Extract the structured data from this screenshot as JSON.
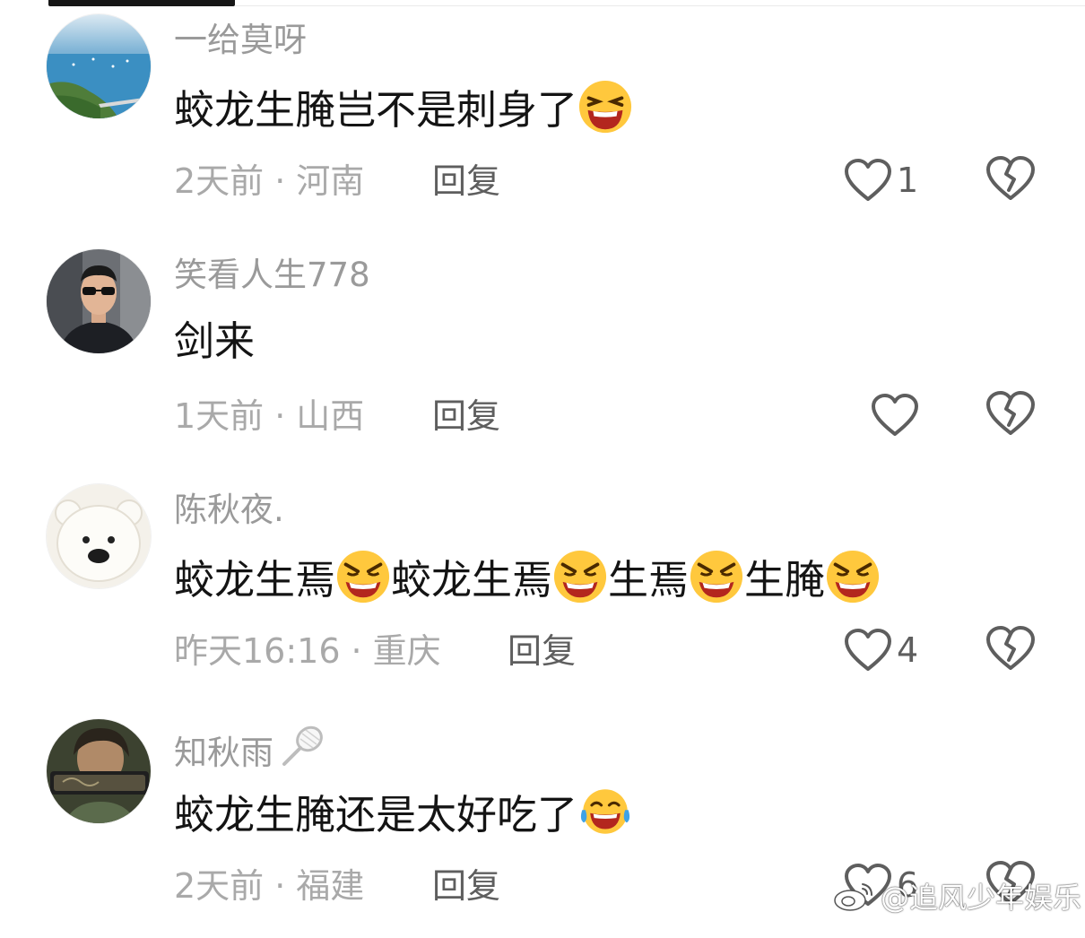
{
  "comments": [
    {
      "username": "一给莫呀",
      "text_parts": [
        "蛟龙生腌岂不是刺身了"
      ],
      "time": "2天前",
      "location": "河南",
      "reply_label": "回复",
      "likes": "1"
    },
    {
      "username": "笑看人生778",
      "text_parts": [
        "剑来"
      ],
      "time": "1天前",
      "location": "山西",
      "reply_label": "回复",
      "likes": ""
    },
    {
      "username": "陈秋夜.",
      "text_parts": [
        "蛟龙生焉",
        "蛟龙生焉",
        "生焉",
        "生腌"
      ],
      "time": "昨天16:16",
      "location": "重庆",
      "reply_label": "回复",
      "likes": "4"
    },
    {
      "username": "知秋雨",
      "text_parts": [
        "蛟龙生腌还是太好吃了"
      ],
      "time": "2天前",
      "location": "福建",
      "reply_label": "回复",
      "likes": "6"
    }
  ],
  "separator": "·",
  "icons": {
    "like": "heart-outline-icon",
    "dislike": "broken-heart-icon",
    "emoji_laugh": "laughing-squint-emoji",
    "emoji_angry": "angry-grin-emoji",
    "emoji_tears": "tears-of-joy-emoji",
    "badge": "badminton-racket-icon",
    "watermark": "weibo-logo-icon"
  },
  "watermark": {
    "text": "@追风少年娱乐"
  },
  "colors": {
    "text": "#141414",
    "meta": "#a9a9a9",
    "username": "#9a9a9a",
    "action": "#5e5e5e",
    "emoji_yellow": "#ffc83d"
  }
}
